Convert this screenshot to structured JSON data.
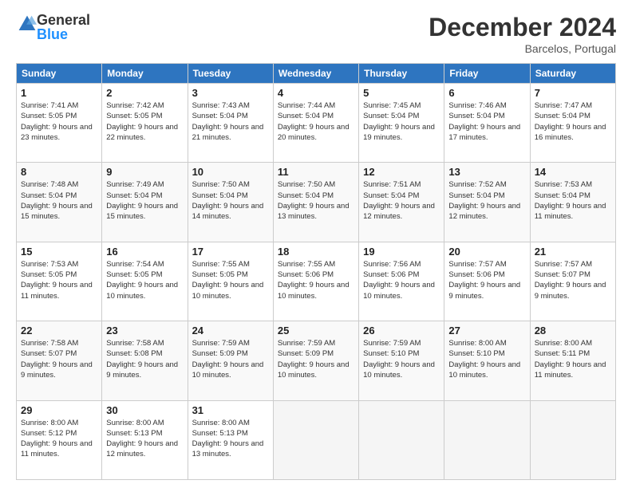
{
  "logo": {
    "general": "General",
    "blue": "Blue"
  },
  "header": {
    "month": "December 2024",
    "location": "Barcelos, Portugal"
  },
  "days_of_week": [
    "Sunday",
    "Monday",
    "Tuesday",
    "Wednesday",
    "Thursday",
    "Friday",
    "Saturday"
  ],
  "weeks": [
    [
      {
        "day": "1",
        "sunrise": "Sunrise: 7:41 AM",
        "sunset": "Sunset: 5:05 PM",
        "daylight": "Daylight: 9 hours and 23 minutes."
      },
      {
        "day": "2",
        "sunrise": "Sunrise: 7:42 AM",
        "sunset": "Sunset: 5:05 PM",
        "daylight": "Daylight: 9 hours and 22 minutes."
      },
      {
        "day": "3",
        "sunrise": "Sunrise: 7:43 AM",
        "sunset": "Sunset: 5:04 PM",
        "daylight": "Daylight: 9 hours and 21 minutes."
      },
      {
        "day": "4",
        "sunrise": "Sunrise: 7:44 AM",
        "sunset": "Sunset: 5:04 PM",
        "daylight": "Daylight: 9 hours and 20 minutes."
      },
      {
        "day": "5",
        "sunrise": "Sunrise: 7:45 AM",
        "sunset": "Sunset: 5:04 PM",
        "daylight": "Daylight: 9 hours and 19 minutes."
      },
      {
        "day": "6",
        "sunrise": "Sunrise: 7:46 AM",
        "sunset": "Sunset: 5:04 PM",
        "daylight": "Daylight: 9 hours and 17 minutes."
      },
      {
        "day": "7",
        "sunrise": "Sunrise: 7:47 AM",
        "sunset": "Sunset: 5:04 PM",
        "daylight": "Daylight: 9 hours and 16 minutes."
      }
    ],
    [
      {
        "day": "8",
        "sunrise": "Sunrise: 7:48 AM",
        "sunset": "Sunset: 5:04 PM",
        "daylight": "Daylight: 9 hours and 15 minutes."
      },
      {
        "day": "9",
        "sunrise": "Sunrise: 7:49 AM",
        "sunset": "Sunset: 5:04 PM",
        "daylight": "Daylight: 9 hours and 15 minutes."
      },
      {
        "day": "10",
        "sunrise": "Sunrise: 7:50 AM",
        "sunset": "Sunset: 5:04 PM",
        "daylight": "Daylight: 9 hours and 14 minutes."
      },
      {
        "day": "11",
        "sunrise": "Sunrise: 7:50 AM",
        "sunset": "Sunset: 5:04 PM",
        "daylight": "Daylight: 9 hours and 13 minutes."
      },
      {
        "day": "12",
        "sunrise": "Sunrise: 7:51 AM",
        "sunset": "Sunset: 5:04 PM",
        "daylight": "Daylight: 9 hours and 12 minutes."
      },
      {
        "day": "13",
        "sunrise": "Sunrise: 7:52 AM",
        "sunset": "Sunset: 5:04 PM",
        "daylight": "Daylight: 9 hours and 12 minutes."
      },
      {
        "day": "14",
        "sunrise": "Sunrise: 7:53 AM",
        "sunset": "Sunset: 5:04 PM",
        "daylight": "Daylight: 9 hours and 11 minutes."
      }
    ],
    [
      {
        "day": "15",
        "sunrise": "Sunrise: 7:53 AM",
        "sunset": "Sunset: 5:05 PM",
        "daylight": "Daylight: 9 hours and 11 minutes."
      },
      {
        "day": "16",
        "sunrise": "Sunrise: 7:54 AM",
        "sunset": "Sunset: 5:05 PM",
        "daylight": "Daylight: 9 hours and 10 minutes."
      },
      {
        "day": "17",
        "sunrise": "Sunrise: 7:55 AM",
        "sunset": "Sunset: 5:05 PM",
        "daylight": "Daylight: 9 hours and 10 minutes."
      },
      {
        "day": "18",
        "sunrise": "Sunrise: 7:55 AM",
        "sunset": "Sunset: 5:06 PM",
        "daylight": "Daylight: 9 hours and 10 minutes."
      },
      {
        "day": "19",
        "sunrise": "Sunrise: 7:56 AM",
        "sunset": "Sunset: 5:06 PM",
        "daylight": "Daylight: 9 hours and 10 minutes."
      },
      {
        "day": "20",
        "sunrise": "Sunrise: 7:57 AM",
        "sunset": "Sunset: 5:06 PM",
        "daylight": "Daylight: 9 hours and 9 minutes."
      },
      {
        "day": "21",
        "sunrise": "Sunrise: 7:57 AM",
        "sunset": "Sunset: 5:07 PM",
        "daylight": "Daylight: 9 hours and 9 minutes."
      }
    ],
    [
      {
        "day": "22",
        "sunrise": "Sunrise: 7:58 AM",
        "sunset": "Sunset: 5:07 PM",
        "daylight": "Daylight: 9 hours and 9 minutes."
      },
      {
        "day": "23",
        "sunrise": "Sunrise: 7:58 AM",
        "sunset": "Sunset: 5:08 PM",
        "daylight": "Daylight: 9 hours and 9 minutes."
      },
      {
        "day": "24",
        "sunrise": "Sunrise: 7:59 AM",
        "sunset": "Sunset: 5:09 PM",
        "daylight": "Daylight: 9 hours and 10 minutes."
      },
      {
        "day": "25",
        "sunrise": "Sunrise: 7:59 AM",
        "sunset": "Sunset: 5:09 PM",
        "daylight": "Daylight: 9 hours and 10 minutes."
      },
      {
        "day": "26",
        "sunrise": "Sunrise: 7:59 AM",
        "sunset": "Sunset: 5:10 PM",
        "daylight": "Daylight: 9 hours and 10 minutes."
      },
      {
        "day": "27",
        "sunrise": "Sunrise: 8:00 AM",
        "sunset": "Sunset: 5:10 PM",
        "daylight": "Daylight: 9 hours and 10 minutes."
      },
      {
        "day": "28",
        "sunrise": "Sunrise: 8:00 AM",
        "sunset": "Sunset: 5:11 PM",
        "daylight": "Daylight: 9 hours and 11 minutes."
      }
    ],
    [
      {
        "day": "29",
        "sunrise": "Sunrise: 8:00 AM",
        "sunset": "Sunset: 5:12 PM",
        "daylight": "Daylight: 9 hours and 11 minutes."
      },
      {
        "day": "30",
        "sunrise": "Sunrise: 8:00 AM",
        "sunset": "Sunset: 5:13 PM",
        "daylight": "Daylight: 9 hours and 12 minutes."
      },
      {
        "day": "31",
        "sunrise": "Sunrise: 8:00 AM",
        "sunset": "Sunset: 5:13 PM",
        "daylight": "Daylight: 9 hours and 13 minutes."
      },
      null,
      null,
      null,
      null
    ]
  ]
}
